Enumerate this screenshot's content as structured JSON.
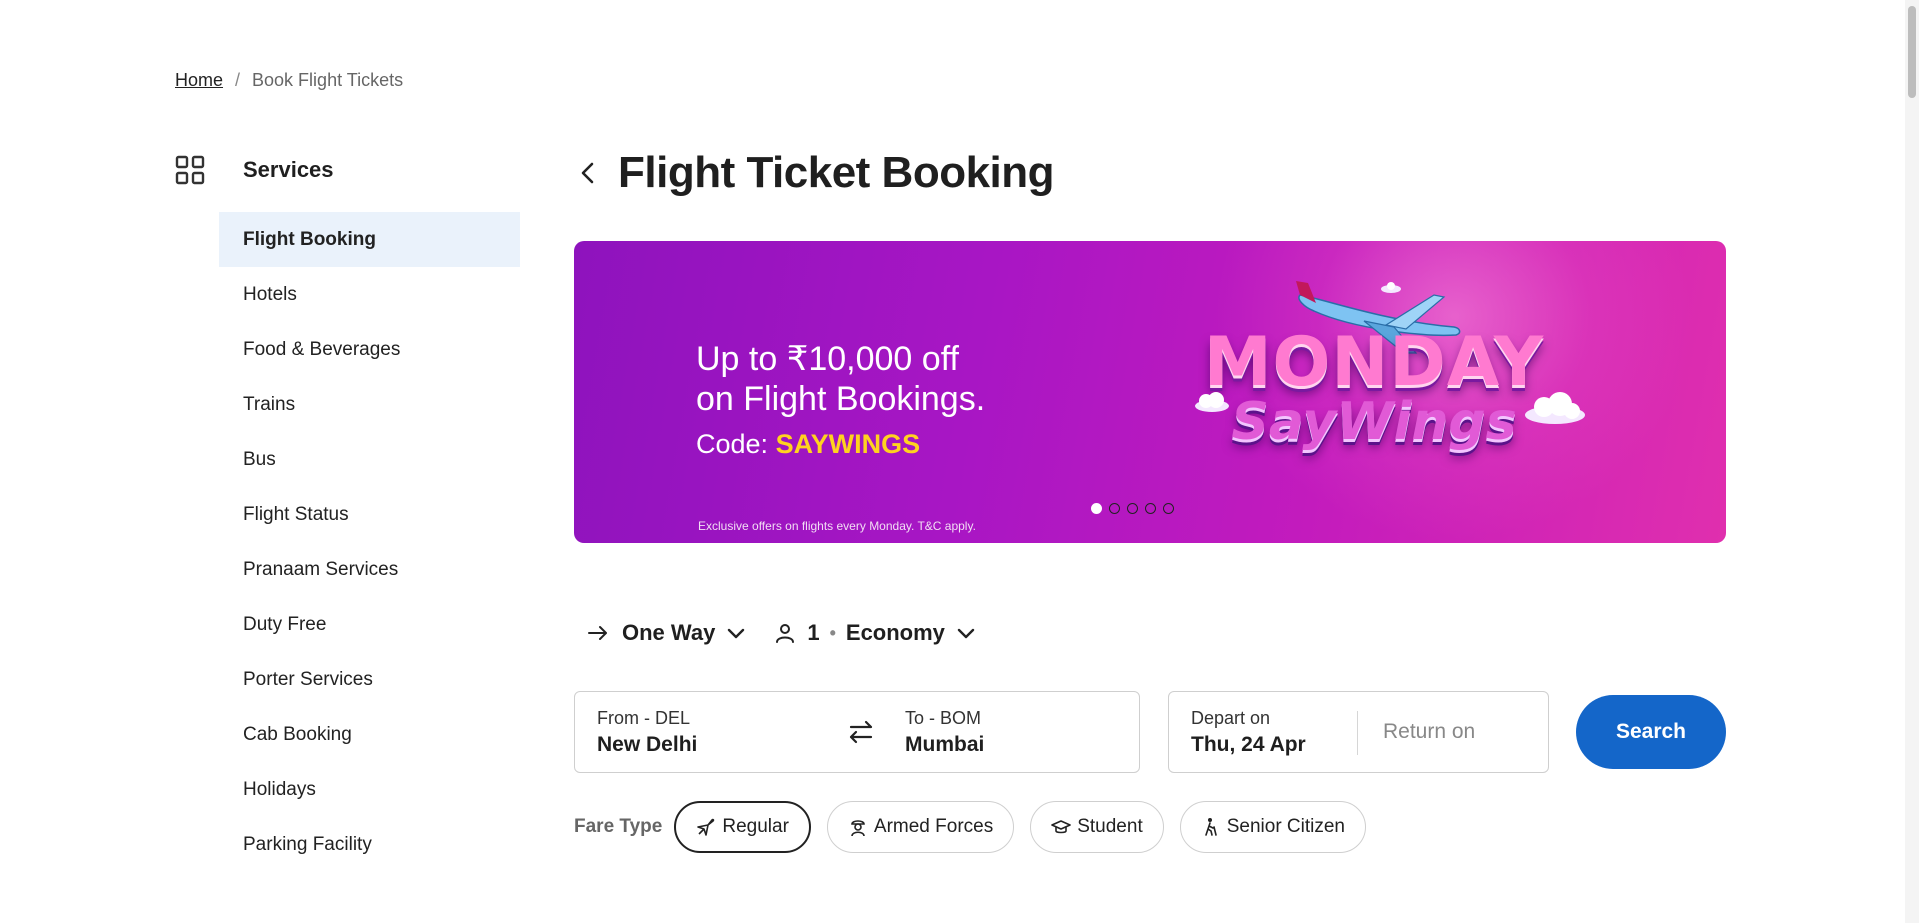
{
  "breadcrumb": {
    "home": "Home",
    "separator": "/",
    "current": "Book Flight Tickets"
  },
  "sidebar": {
    "title": "Services",
    "icon": "grid-icon",
    "items": [
      {
        "label": "Flight Booking",
        "active": true
      },
      {
        "label": "Hotels"
      },
      {
        "label": "Food & Beverages"
      },
      {
        "label": "Trains"
      },
      {
        "label": "Bus"
      },
      {
        "label": "Flight Status"
      },
      {
        "label": "Pranaam Services"
      },
      {
        "label": "Duty Free"
      },
      {
        "label": "Porter Services"
      },
      {
        "label": "Cab Booking"
      },
      {
        "label": "Holidays"
      },
      {
        "label": "Parking Facility"
      }
    ]
  },
  "main": {
    "title": "Flight Ticket Booking"
  },
  "banner": {
    "line1": "Up to ₹10,000 off",
    "line2": "on Flight Bookings.",
    "code_label": "Code: ",
    "code": "SAYWINGS",
    "fine_print": "Exclusive offers on flights every Monday. T&C apply.",
    "brand_line1": "MONDAY",
    "brand_line2": "SayWings",
    "slides": 5,
    "active_slide": 1
  },
  "trip": {
    "type": "One Way",
    "passengers": "1",
    "cabin": "Economy"
  },
  "search": {
    "from_label": "From - DEL",
    "from_value": "New Delhi",
    "to_label": "To - BOM",
    "to_value": "Mumbai",
    "depart_label": "Depart on",
    "depart_value": "Thu, 24 Apr",
    "return_placeholder": "Return on",
    "button": "Search"
  },
  "fare": {
    "label": "Fare Type",
    "options": [
      {
        "label": "Regular",
        "icon": "plane-icon",
        "selected": true
      },
      {
        "label": "Armed Forces",
        "icon": "soldier-icon"
      },
      {
        "label": "Student",
        "icon": "graduation-cap-icon"
      },
      {
        "label": "Senior Citizen",
        "icon": "senior-walking-icon"
      }
    ]
  },
  "colors": {
    "accent": "#1466c9",
    "banner_start": "#8e13bd",
    "banner_end": "#e02fae",
    "promo_code": "#ffd21f",
    "active_nav_bg": "#eaf2fb"
  }
}
